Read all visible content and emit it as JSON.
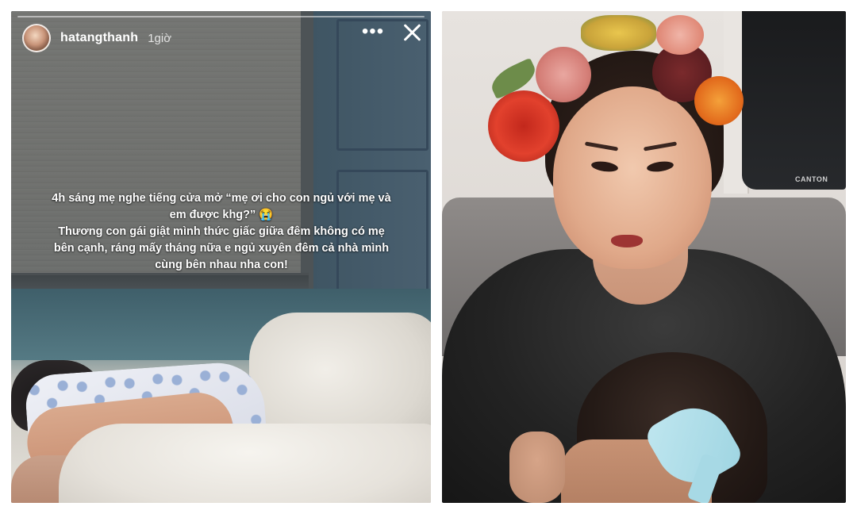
{
  "story": {
    "username": "hatangthanh",
    "time_ago": "1giờ",
    "more_icon": "•••",
    "caption_lines": [
      "4h sáng mẹ nghe tiếng cửa mở “mẹ ơi cho con ngủ với mẹ và",
      "em được khg?” 😭",
      "Thương con gái giật mình thức giấc giữa đêm không có mẹ",
      "bên cạnh, ráng mấy tháng nữa e ngủ xuyên đêm cả nhà mình",
      "cùng bên nhau nha con!"
    ]
  },
  "photo": {
    "speaker_brand": "CANTON"
  },
  "icons": {
    "more": "more-horizontal-icon",
    "close": "close-icon"
  },
  "colors": {
    "caption_text": "#ffffff",
    "page_background": "#ffffff"
  }
}
